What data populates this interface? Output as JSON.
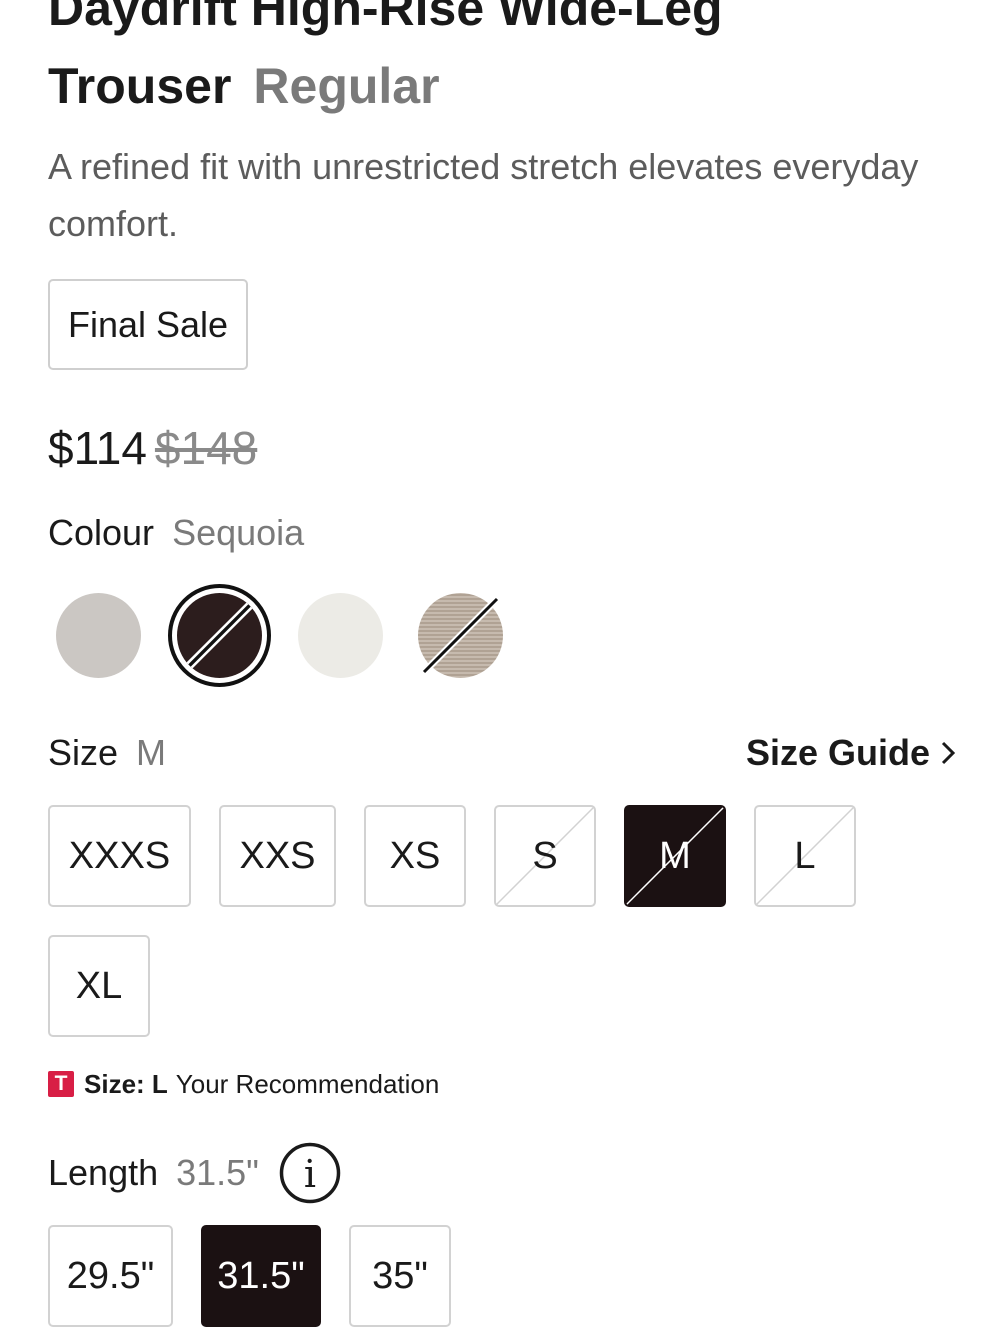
{
  "product": {
    "title_line1": "Daydrift High-Rise Wide-Leg",
    "title_line2": "Trouser",
    "fit": "Regular",
    "description": "A refined fit with unrestricted stretch elevates everyday comfort.",
    "badge": "Final Sale",
    "price": "$114",
    "original_price": "$148"
  },
  "colour": {
    "label": "Colour",
    "selected": "Sequoia",
    "swatches": [
      {
        "color": "#cbc7c3",
        "available": true,
        "selected": false
      },
      {
        "color": "#2c1d1d",
        "available": false,
        "selected": true
      },
      {
        "color": "#ecebe6",
        "available": true,
        "selected": false
      },
      {
        "color": "#b9ab9c",
        "available": false,
        "selected": false
      }
    ]
  },
  "size": {
    "label": "Size",
    "selected": "M",
    "guide_label": "Size Guide",
    "options": [
      {
        "label": "XXXS",
        "available": true,
        "selected": false
      },
      {
        "label": "XXS",
        "available": true,
        "selected": false
      },
      {
        "label": "XS",
        "available": true,
        "selected": false
      },
      {
        "label": "S",
        "available": false,
        "selected": false
      },
      {
        "label": "M",
        "available": false,
        "selected": true
      },
      {
        "label": "L",
        "available": false,
        "selected": false
      },
      {
        "label": "XL",
        "available": true,
        "selected": false
      }
    ],
    "recommendation": {
      "icon_letter": "T",
      "prefix": "Size: L",
      "text": "Your Recommendation"
    }
  },
  "length": {
    "label": "Length",
    "selected": "31.5\"",
    "info_icon": "i",
    "options": [
      {
        "label": "29.5\"",
        "selected": false
      },
      {
        "label": "31.5\"",
        "selected": true
      },
      {
        "label": "35\"",
        "selected": false
      }
    ]
  },
  "colors": {
    "accent_dark": "#1b1112",
    "recommendation_red": "#d81e45",
    "muted_text": "#7a7a7a"
  }
}
